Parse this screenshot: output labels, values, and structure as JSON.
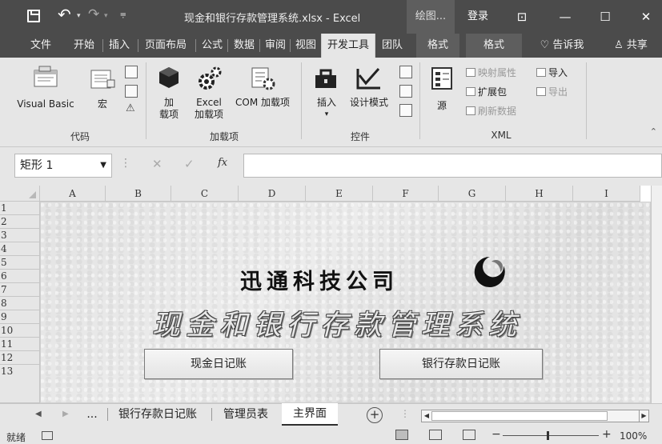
{
  "window": {
    "title": "现金和银行存款管理系统.xlsx - Excel",
    "contextual_tab_group": "绘图...",
    "login": "登录"
  },
  "tabs": [
    "文件",
    "开始",
    "插入",
    "页面布局",
    "公式",
    "数据",
    "审阅",
    "视图",
    "开发工具",
    "团队",
    "格式",
    "格式"
  ],
  "tellme": "告诉我",
  "share": "共享",
  "ribbon": {
    "code": {
      "label": "代码",
      "visual_basic": "Visual Basic",
      "macros": "宏"
    },
    "addins": {
      "label": "加载项",
      "addins_line1": "加",
      "addins_line2": "载项",
      "excel_addins_line1": "Excel",
      "excel_addins_line2": "加载项",
      "com_addins": "COM 加载项"
    },
    "controls": {
      "label": "控件",
      "insert": "插入",
      "design_mode": "设计模式"
    },
    "xml": {
      "label": "XML",
      "source": "源",
      "map_properties": "映射属性",
      "expansion_packs": "扩展包",
      "refresh_data": "刷新数据",
      "import": "导入",
      "export": "导出"
    }
  },
  "formula_bar": {
    "name_box": "矩形 1",
    "fx": "fx",
    "formula": ""
  },
  "grid": {
    "columns": [
      "A",
      "B",
      "C",
      "D",
      "E",
      "F",
      "G",
      "H",
      "I"
    ],
    "rows": [
      "1",
      "2",
      "3",
      "4",
      "5",
      "6",
      "7",
      "8",
      "9",
      "10",
      "11",
      "12",
      "13"
    ]
  },
  "panel": {
    "company": "迅通科技公司",
    "system_title": "现金和银行存款管理系统",
    "buttons": [
      "现金日记账",
      "银行存款日记账"
    ]
  },
  "sheet_tabs": {
    "ellipsis": "...",
    "tabs": [
      "银行存款日记账",
      "管理员表",
      "主界面"
    ],
    "active": "主界面"
  },
  "status": {
    "ready": "就绪",
    "zoom": "100%"
  }
}
